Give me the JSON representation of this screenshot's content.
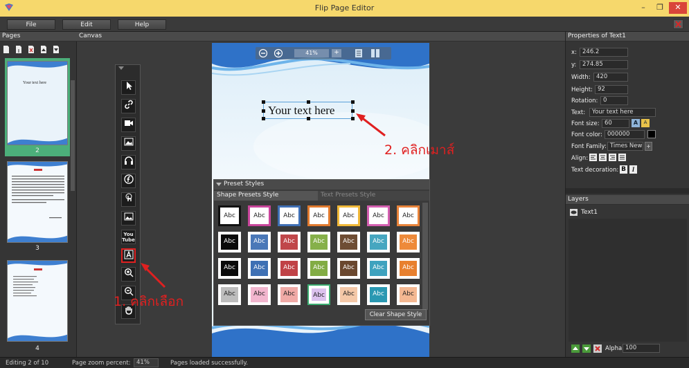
{
  "window": {
    "title": "Flip Page Editor",
    "minimize": "–",
    "restore": "❐",
    "close": "✕"
  },
  "menu": {
    "file": "File",
    "edit": "Edit",
    "help": "Help"
  },
  "pages_panel": {
    "title": "Pages",
    "thumbs": [
      {
        "number": "2",
        "text": "Your text here",
        "selected": true
      },
      {
        "number": "3",
        "text": "",
        "selected": false
      },
      {
        "number": "4",
        "text": "",
        "selected": false
      }
    ]
  },
  "canvas": {
    "title": "Canvas",
    "zoom": "41%",
    "text_object": "Your text here"
  },
  "presets": {
    "title": "Preset Styles",
    "tab_shape": "Shape Presets Style",
    "tab_text": "Text Presets Style",
    "swatch_label": "Abc",
    "clear_button": "Clear Shape Style",
    "row1_border_colors": [
      "#111111",
      "#c8459a",
      "#3f6fb4",
      "#e07a2e",
      "#f0b838",
      "#d45fb0",
      "#e8833a"
    ],
    "row2_fill_colors": [
      "#0a0a0a",
      "#4a78b8",
      "#c0474a",
      "#86b04a",
      "#6e4d34",
      "#46a6c0",
      "#ee8a3a"
    ],
    "row3_fill_colors": [
      "#0a0a0a",
      "#3e70b4",
      "#c04246",
      "#82ac44",
      "#6a472e",
      "#3ea2be",
      "#e8802e"
    ],
    "row4_fill_colors": [
      "#bdbdbd",
      "#f2b6ce",
      "#f0aaa6",
      "#dcc2ee",
      "#f4c8a8",
      "#2a98b2",
      "#f4b892"
    ]
  },
  "properties": {
    "title": "Properties of Text1",
    "x_label": "x:",
    "x": "246.2",
    "y_label": "y:",
    "y": "274.85",
    "width_label": "Width:",
    "width": "420",
    "height_label": "Height:",
    "height": "92",
    "rotation_label": "Rotation:",
    "rotation": "0",
    "text_label": "Text:",
    "text": "Your text here",
    "font_size_label": "Font size:",
    "font_size": "60",
    "font_color_label": "Font color:",
    "font_color": "000000",
    "font_family_label": "Font Family:",
    "font_family": "Times New R",
    "align_label": "Align:",
    "text_decoration_label": "Text decoration:",
    "bold": "B",
    "italic": "I",
    "plus": "+"
  },
  "layers": {
    "title": "Layers",
    "items": [
      "Text1"
    ],
    "alpha_label": "Alpha:",
    "alpha": "100"
  },
  "status": {
    "editing": "Editing 2 of 10",
    "zoom_label": "Page zoom percent:",
    "zoom_value": "41%",
    "message": "Pages loaded successfully."
  },
  "annotations": {
    "step1": "1. คลิกเลือก",
    "step2": "2. คลิกเมาส์"
  },
  "colors": {
    "titlebar": "#f6d86c",
    "accent_green": "#4caf7a",
    "annotation_red": "#e02020"
  }
}
